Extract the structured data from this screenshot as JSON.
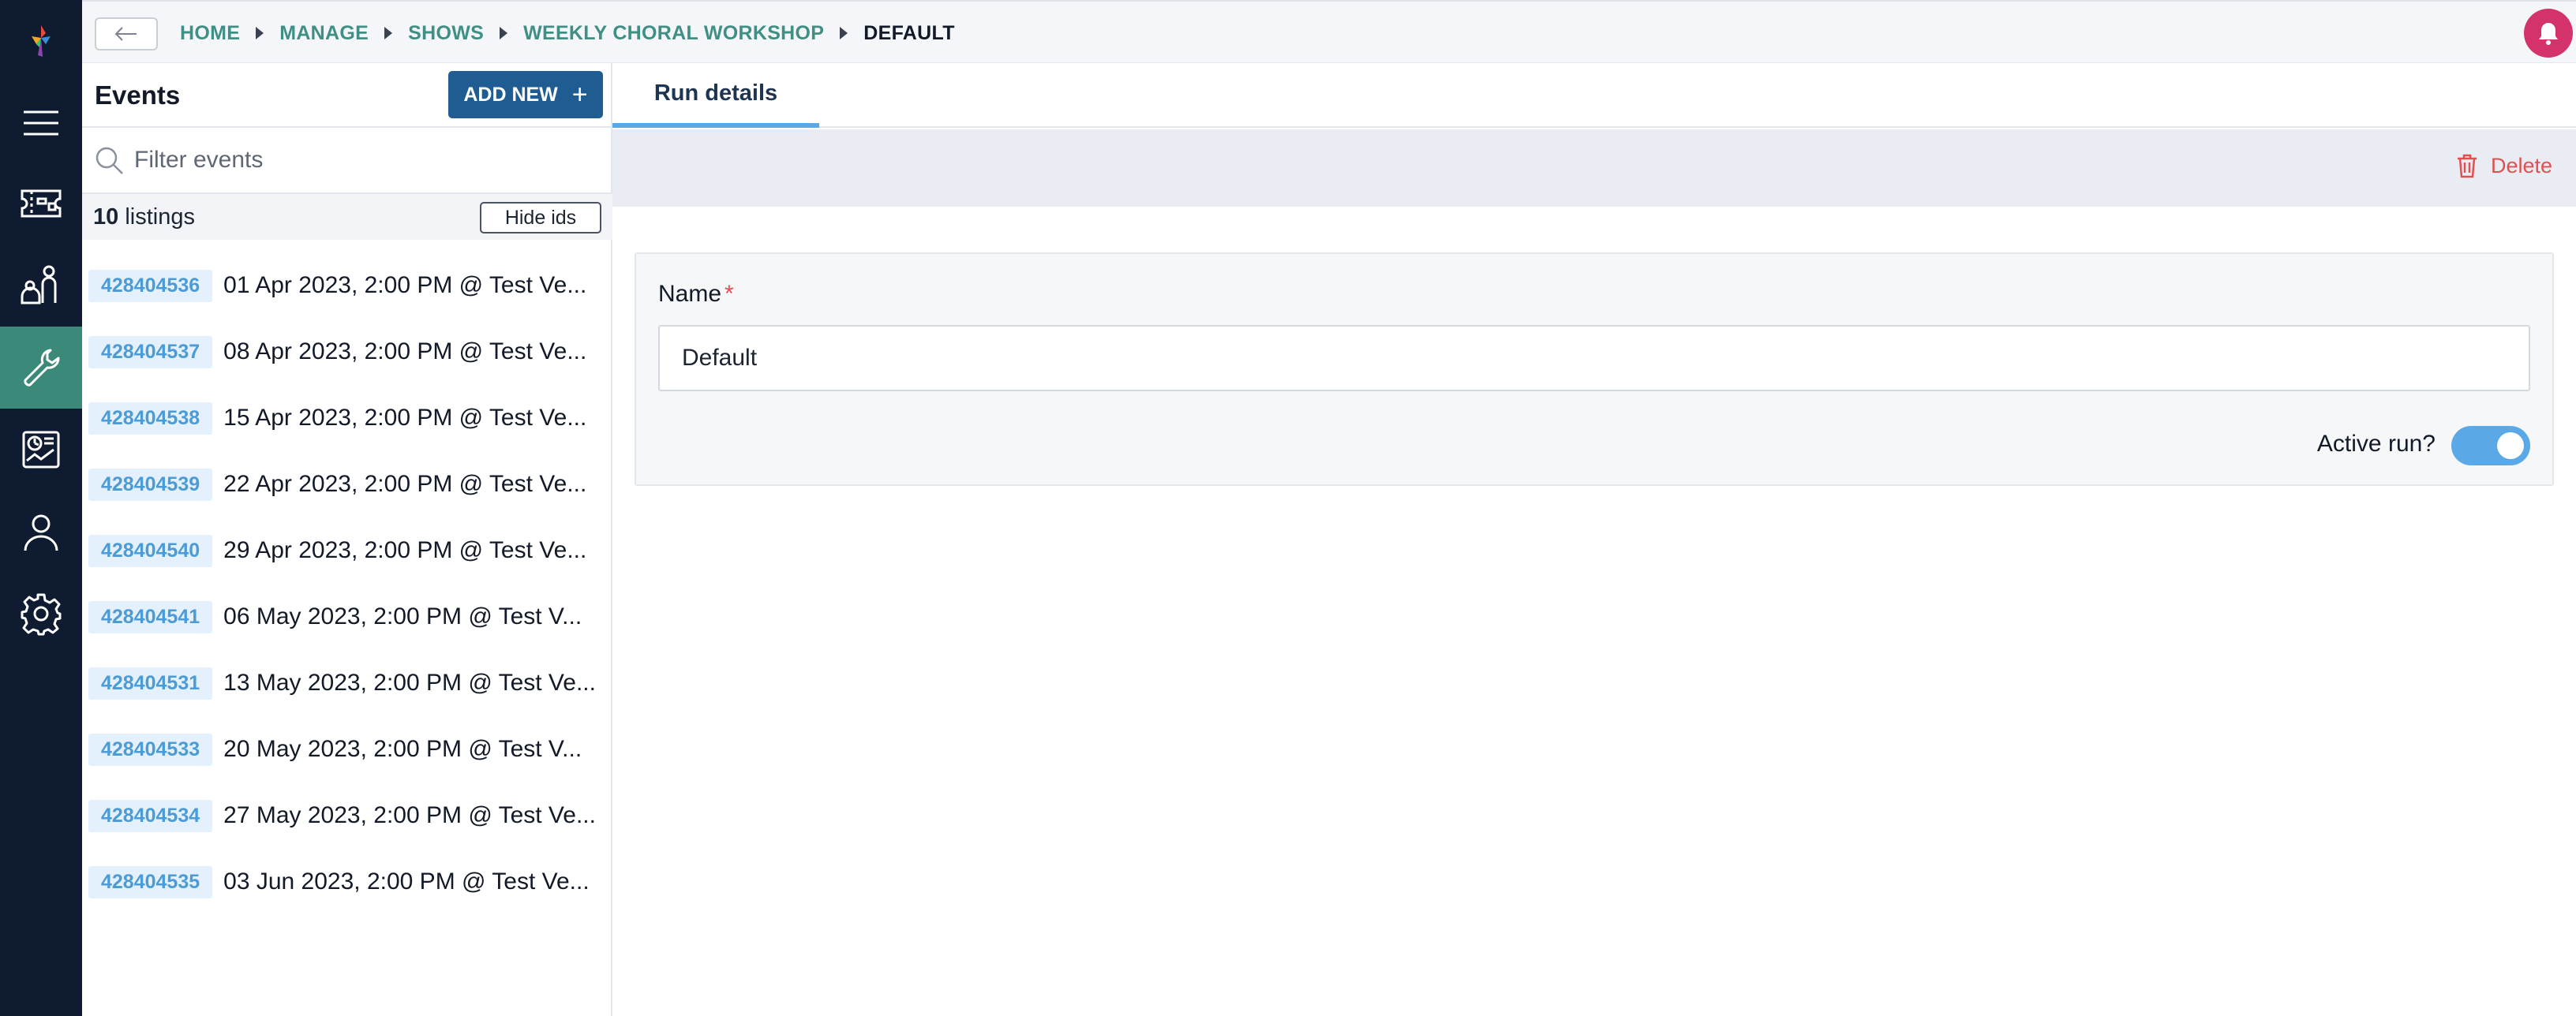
{
  "nav": {
    "items": [
      {
        "name": "logo-icon"
      },
      {
        "name": "menu-icon"
      },
      {
        "name": "ticket-icon"
      },
      {
        "name": "audience-icon"
      },
      {
        "name": "wrench-icon",
        "active": true
      },
      {
        "name": "reports-icon"
      },
      {
        "name": "user-icon"
      },
      {
        "name": "settings-icon"
      }
    ],
    "active_color": "#3b8a79",
    "background": "#0f1b30"
  },
  "breadcrumb": {
    "items": [
      "HOME",
      "MANAGE",
      "SHOWS",
      "WEEKLY CHORAL WORKSHOP",
      "DEFAULT"
    ]
  },
  "events": {
    "title": "Events",
    "add_new_label": "ADD NEW",
    "filter_placeholder": "Filter events",
    "listing_count": "10",
    "listing_word": "listings",
    "hide_ids_label": "Hide ids",
    "items": [
      {
        "id": "428404536",
        "text": "01 Apr 2023, 2:00 PM @ Test Ve..."
      },
      {
        "id": "428404537",
        "text": "08 Apr 2023, 2:00 PM @ Test Ve..."
      },
      {
        "id": "428404538",
        "text": "15 Apr 2023, 2:00 PM @ Test Ve..."
      },
      {
        "id": "428404539",
        "text": "22 Apr 2023, 2:00 PM @ Test Ve..."
      },
      {
        "id": "428404540",
        "text": "29 Apr 2023, 2:00 PM @ Test Ve..."
      },
      {
        "id": "428404541",
        "text": "06 May 2023, 2:00 PM @ Test V..."
      },
      {
        "id": "428404531",
        "text": "13 May 2023, 2:00 PM @ Test Ve..."
      },
      {
        "id": "428404533",
        "text": "20 May 2023, 2:00 PM @ Test V..."
      },
      {
        "id": "428404534",
        "text": "27 May 2023, 2:00 PM @ Test Ve..."
      },
      {
        "id": "428404535",
        "text": "03 Jun 2023, 2:00 PM @ Test Ve..."
      }
    ]
  },
  "main": {
    "tab_label": "Run details",
    "delete_label": "Delete",
    "name_label": "Name",
    "required_mark": "*",
    "name_value": "Default",
    "active_run_label": "Active run?",
    "active_run": true
  },
  "colors": {
    "accent": "#5aa9e6",
    "primary_button": "#1e5c91",
    "danger": "#e05050",
    "notification": "#d3326a",
    "breadcrumb_link": "#3f8f84"
  }
}
